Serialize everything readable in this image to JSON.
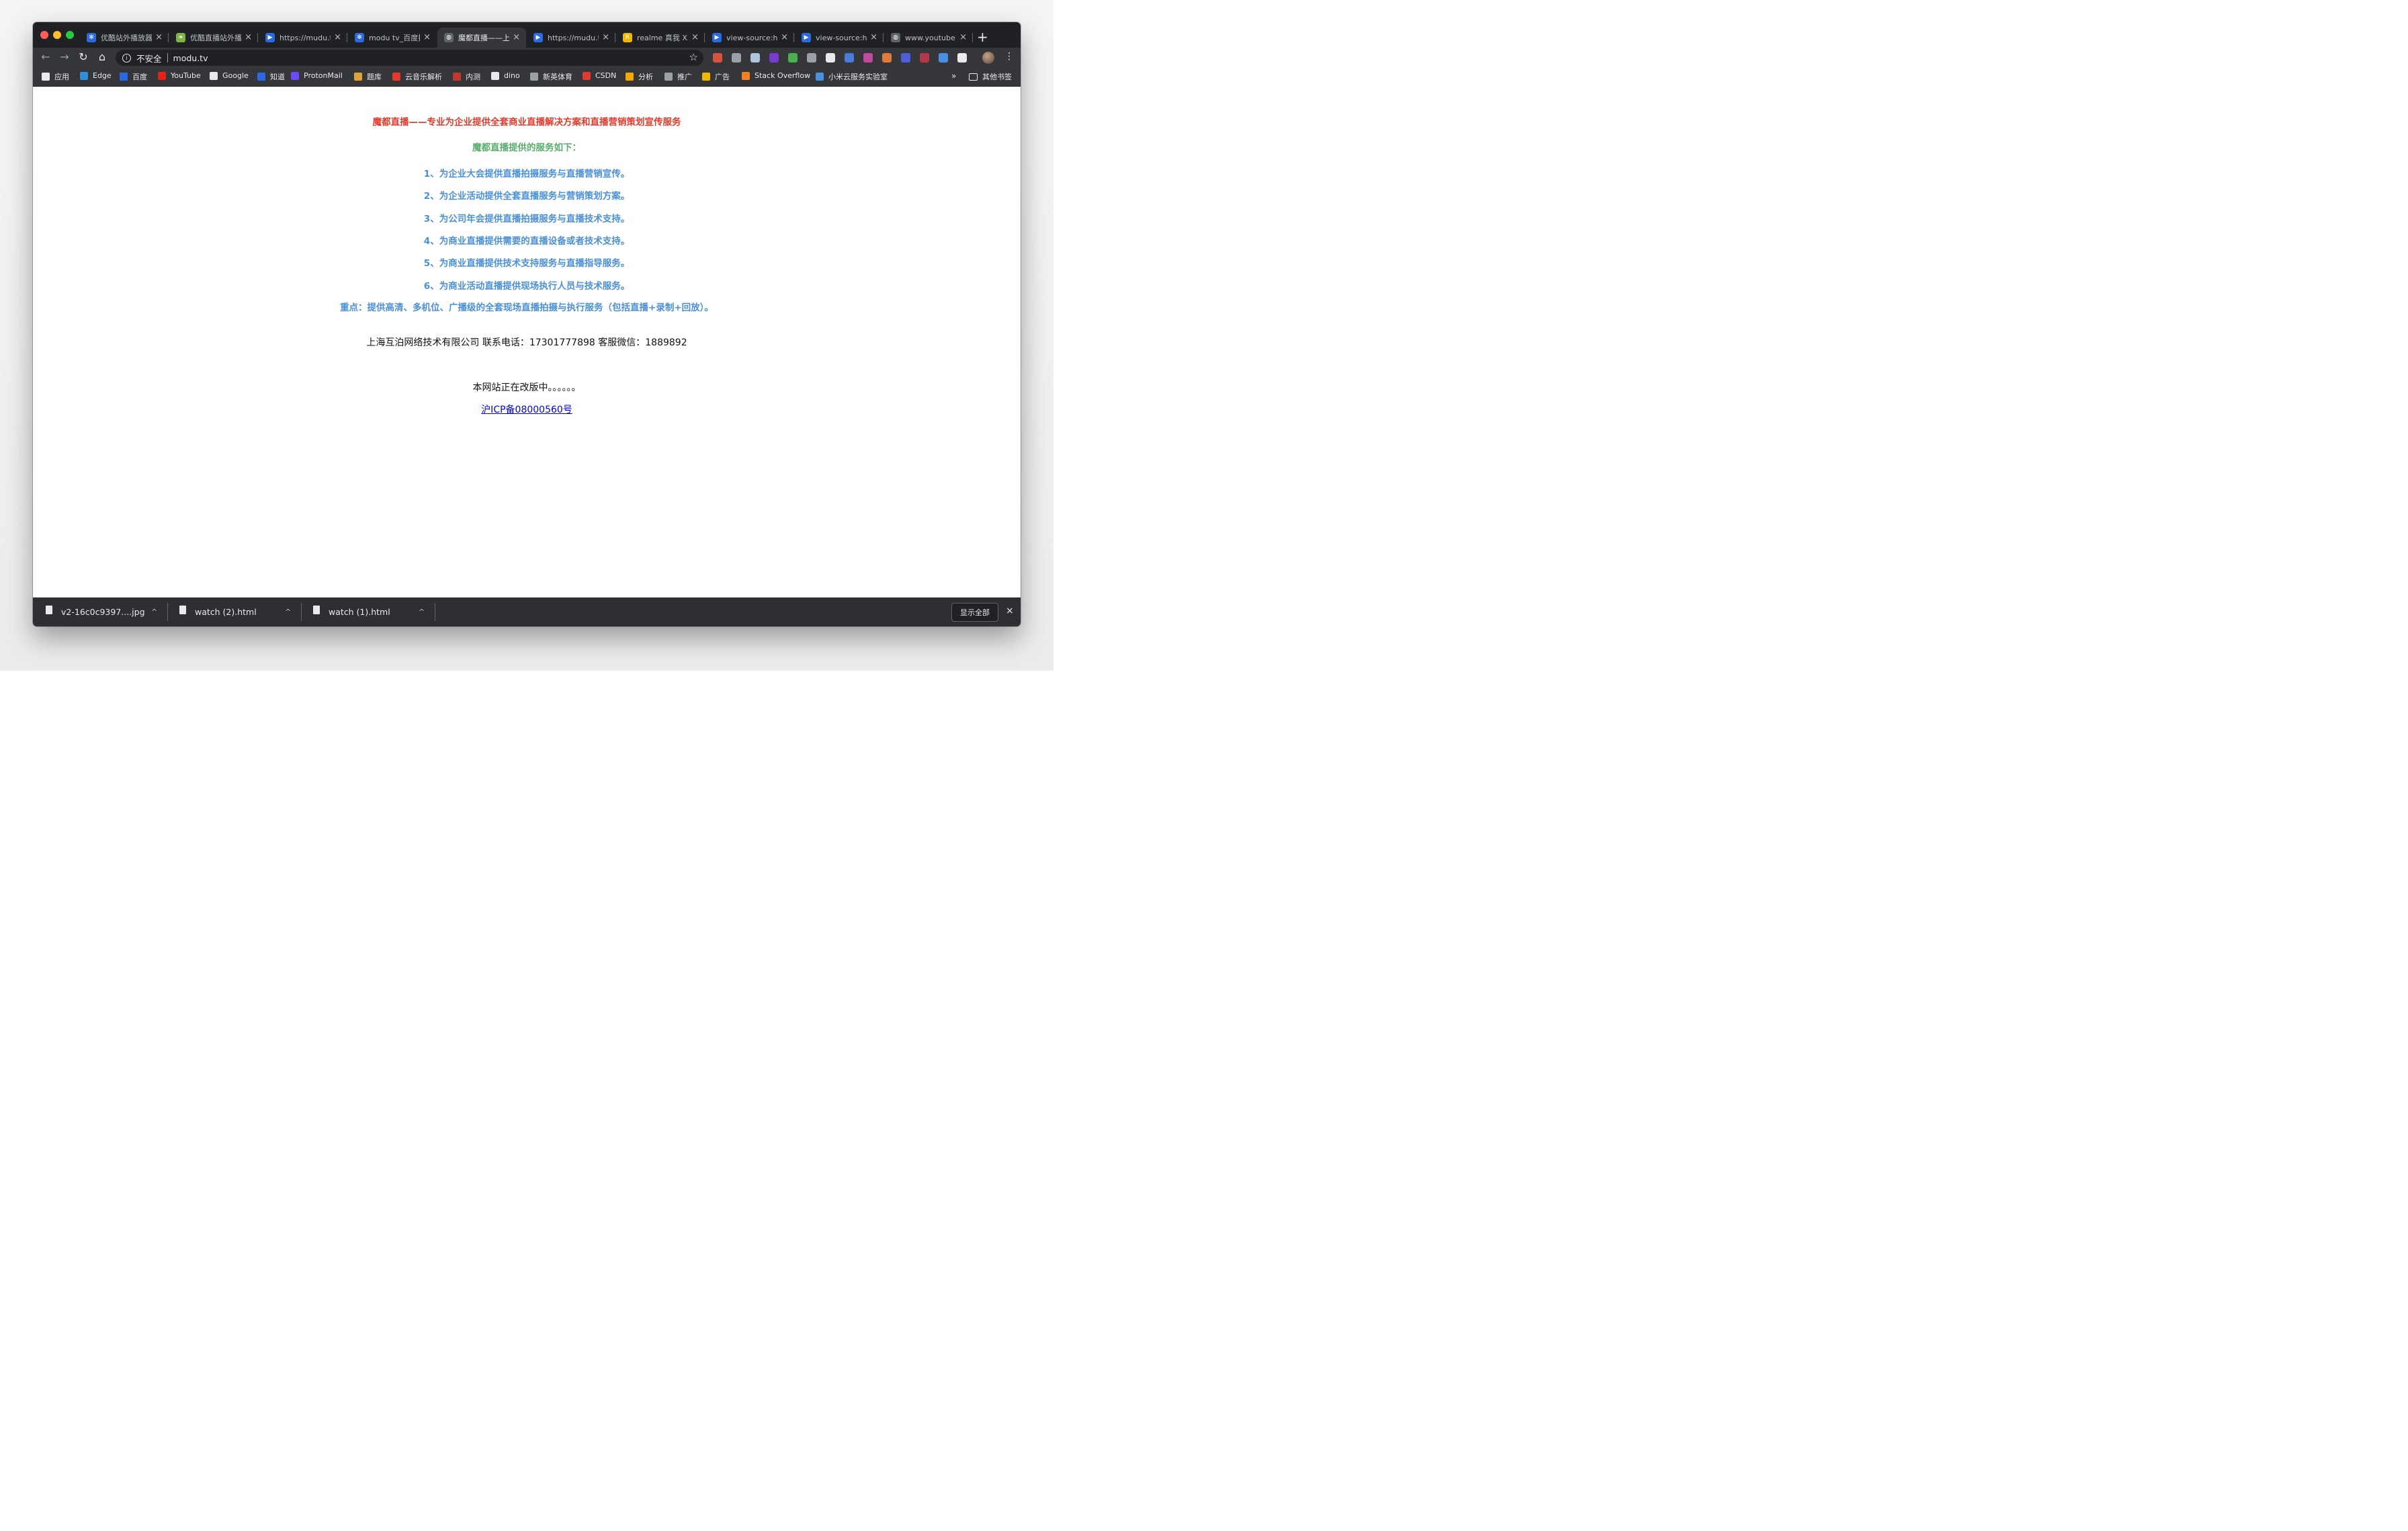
{
  "tabs": [
    {
      "label": "优酷站外播放器",
      "close": "×",
      "icon_color": "#2b6ae0",
      "icon": "paw-icon"
    },
    {
      "label": "优酷直播站外播",
      "close": "×",
      "icon_color": "#7fb34a",
      "icon": "leaf-icon"
    },
    {
      "label": "https://mudu.tv",
      "close": "×",
      "icon_color": "#2b6ae0",
      "icon": "play-icon"
    },
    {
      "label": "modu tv_百度搜索",
      "close": "×",
      "icon_color": "#2b6ae0",
      "icon": "paw-icon"
    },
    {
      "label": "魔都直播——上",
      "close": "×",
      "icon_color": "#5f6368",
      "icon": "globe-icon"
    },
    {
      "label": "https://mudu.tv",
      "close": "×",
      "icon_color": "#2b6ae0",
      "icon": "play-icon"
    },
    {
      "label": "realme 真我 X5",
      "close": "×",
      "icon_color": "#f2b600",
      "icon": "r-icon"
    },
    {
      "label": "view-source:ht",
      "close": "×",
      "icon_color": "#2b6ae0",
      "icon": "play-icon"
    },
    {
      "label": "view-source:ht",
      "close": "×",
      "icon_color": "#2b6ae0",
      "icon": "play-icon"
    },
    {
      "label": "www.youtube.c",
      "close": "×",
      "icon_color": "#5f6368",
      "icon": "globe-icon"
    }
  ],
  "active_tab_index": 4,
  "new_tab": "+",
  "toolbar": {
    "back": "←",
    "forward": "→",
    "reload": "↻",
    "home": "⌂",
    "security_label": "不安全",
    "url": "modu.tv",
    "star": "☆",
    "menu": "⋮"
  },
  "extensions": [
    "#d9523f",
    "#9aa0a6",
    "#b0c4de",
    "#7a3ccf",
    "#4caf50",
    "#9aa0a6",
    "#e8eaed",
    "#4a7bd9",
    "#c04a9e",
    "#e07b39",
    "#4a5fd9",
    "#b03a4a",
    "#4a90e2",
    "#e8eaed"
  ],
  "bookmarks": [
    {
      "label": "应用",
      "color": "#e8eaed"
    },
    {
      "label": "Edge",
      "color": "#2f8fd8"
    },
    {
      "label": "百度",
      "color": "#2b6ae0"
    },
    {
      "label": "YouTube",
      "color": "#e62117"
    },
    {
      "label": "Google",
      "color": "#e8eaed"
    },
    {
      "label": "知道",
      "color": "#2b6ae0"
    },
    {
      "label": "ProtonMail",
      "color": "#6d4aff"
    },
    {
      "label": "题库",
      "color": "#e0a23b"
    },
    {
      "label": "云音乐解析",
      "color": "#e03b2d"
    },
    {
      "label": "内测",
      "color": "#c0392b"
    },
    {
      "label": "dino",
      "color": "#e8eaed"
    },
    {
      "label": "新英体育",
      "color": "#9aa0a6"
    },
    {
      "label": "CSDN",
      "color": "#e03b2d"
    },
    {
      "label": "分析",
      "color": "#f2a900"
    },
    {
      "label": "推广",
      "color": "#9aa0a6"
    },
    {
      "label": "广告",
      "color": "#f2b600"
    },
    {
      "label": "Stack Overflow",
      "color": "#f48024"
    },
    {
      "label": "小米云服务实验室",
      "color": "#4a90e2"
    }
  ],
  "bookmarks_more": "»",
  "other_bookmarks": "其他书签",
  "page": {
    "headline": "魔都直播——专业为企业提供全套商业直播解决方案和直播营销策划宣传服务",
    "services_title": "魔都直播提供的服务如下：",
    "services": [
      "1、为企业大会提供直播拍摄服务与直播营销宣传。",
      "2、为企业活动提供全套直播服务与营销策划方案。",
      "3、为公司年会提供直播拍摄服务与直播技术支持。",
      "4、为商业直播提供需要的直播设备或者技术支持。",
      "5、为商业直播提供技术支持服务与直播指导服务。",
      "6、为商业活动直播提供现场执行人员与技术服务。"
    ],
    "key_point": "重点：提供高清、多机位、广播级的全套现场直播拍摄与执行服务（包括直播+录制+回放）。",
    "contact": "上海互泊网络技术有限公司  联系电话：17301777898  客服微信：1889892",
    "notice": "本网站正在改版中。。。。。。",
    "icp_link": "沪ICP备08000560号"
  },
  "downloads": [
    {
      "name": "v2-16c0c9397....jpg",
      "caret": "^"
    },
    {
      "name": "watch (2).html",
      "caret": "^"
    },
    {
      "name": "watch (1).html",
      "caret": "^"
    }
  ],
  "shelf": {
    "show_all": "显示全部",
    "close": "×"
  }
}
